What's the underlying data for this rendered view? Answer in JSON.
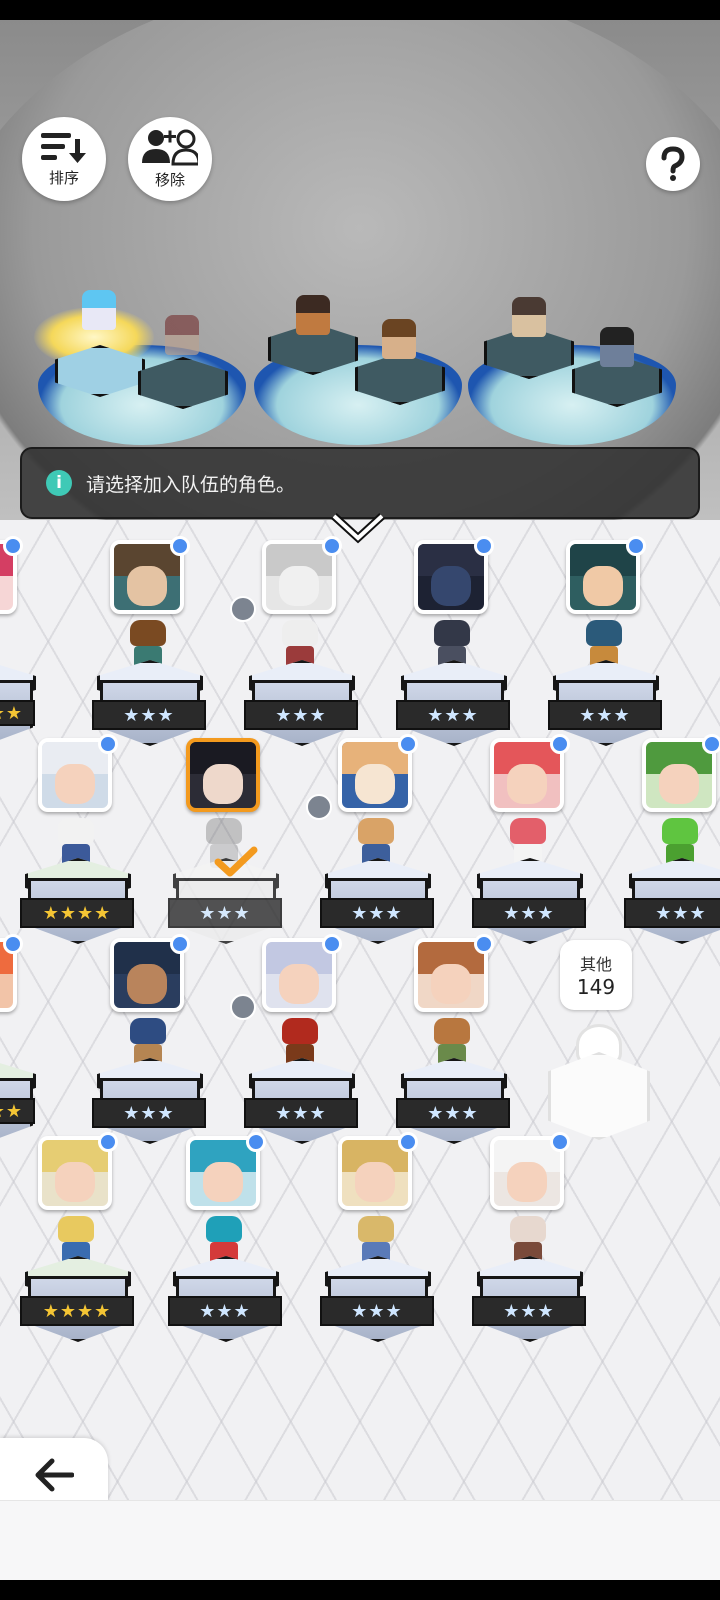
{
  "toolbar": {
    "sort_label": "排序",
    "remove_label": "移除",
    "help_icon": "question-mark-icon"
  },
  "info": {
    "message": "请选择加入队伍的角色。"
  },
  "stars": {
    "three": "★★★",
    "four": "★★★★",
    "two": "★★"
  },
  "others": {
    "label": "其他",
    "count": "149"
  },
  "back": {
    "label": "返回"
  }
}
